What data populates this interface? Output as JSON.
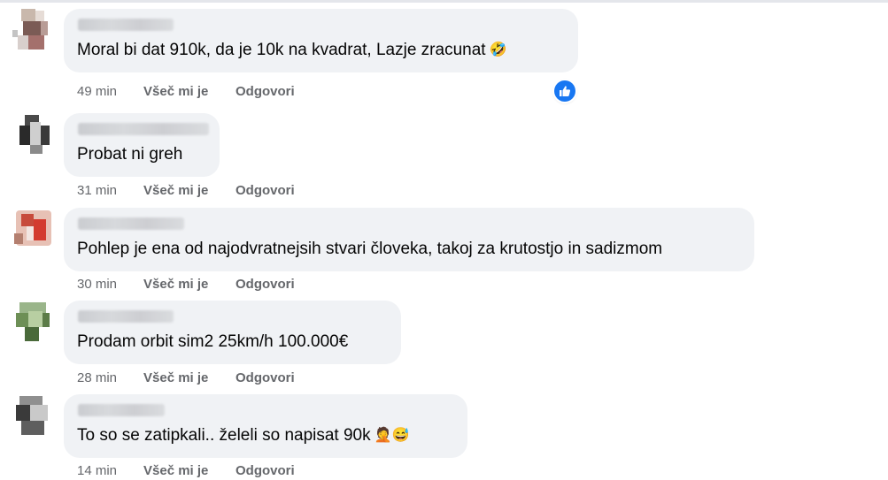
{
  "comments": [
    {
      "text": "Moral bi dat 910k, da je 10k na kvadrat, Lazje zracunat",
      "emoji": "🤣",
      "time": "49 min",
      "like_label": "Všeč mi je",
      "reply_label": "Odgovori",
      "has_like_reaction": true
    },
    {
      "text": "Probat ni greh",
      "emoji": "",
      "time": "31 min",
      "like_label": "Všeč mi je",
      "reply_label": "Odgovori"
    },
    {
      "text": "Pohlep je ena od najodvratnejsih stvari človeka, takoj za krutostjo in sadizmom",
      "emoji": "",
      "time": "30 min",
      "like_label": "Všeč mi je",
      "reply_label": "Odgovori"
    },
    {
      "text": "Prodam orbit sim2 25km/h 100.000€",
      "emoji": "",
      "time": "28 min",
      "like_label": "Všeč mi je",
      "reply_label": "Odgovori"
    },
    {
      "text": "To so se zatipkali.. želeli so napisat 90k",
      "emoji": "🤦😅",
      "time": "14 min",
      "like_label": "Všeč mi je",
      "reply_label": "Odgovori"
    }
  ],
  "colors": {
    "bubble": "#f0f2f5",
    "meta_text": "#65676b",
    "like_blue": "#1877f2"
  },
  "icons": {
    "reaction": "thumbs-up-icon"
  }
}
